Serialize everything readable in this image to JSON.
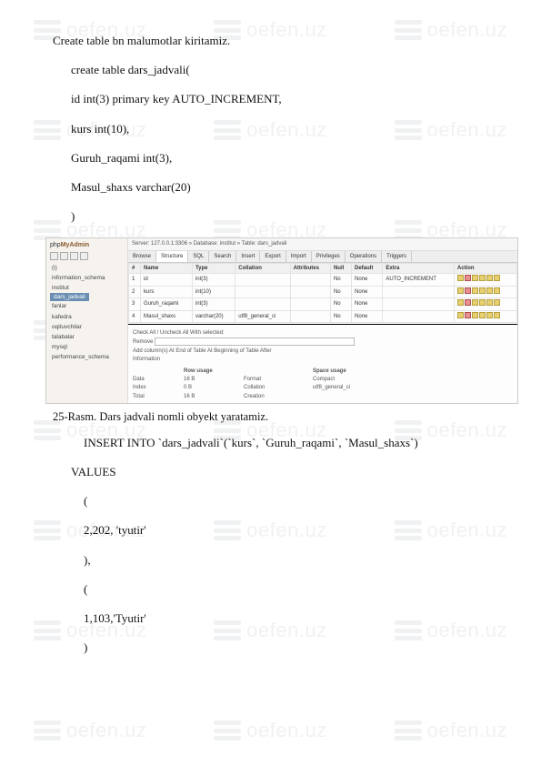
{
  "watermark": "oefen.uz",
  "body": {
    "l1": "Create table bn malumotlar kiritamiz.",
    "l2": "create table dars_jadvali(",
    "l3": "id int(3) primary key AUTO_INCREMENT,",
    "l4": "kurs int(10),",
    "l5": "Guruh_raqami int(3),",
    "l6": "Masul_shaxs varchar(20)",
    "l7": ")"
  },
  "shot": {
    "logo_a": "php",
    "logo_b": "MyAdmin",
    "tree": {
      "t1": "(i)",
      "t2": "information_schema",
      "t3": "institut",
      "t4": "dars_jadvali",
      "t5": "fanlar",
      "t6": "kafedra",
      "t7": "oqituvchilar",
      "t8": "talabalar",
      "t9": "mysql",
      "t10": "performance_schema"
    },
    "crumb": "Server: 127.0.0.1:3306 » Database: institut » Table: dars_jadvali",
    "tabs": {
      "a": "Browse",
      "b": "Structure",
      "c": "SQL",
      "d": "Search",
      "e": "Insert",
      "f": "Export",
      "g": "Import",
      "h": "Privileges",
      "i": "Operations",
      "j": "Triggers"
    },
    "grid": {
      "h_num": "#",
      "h_name": "Name",
      "h_type": "Type",
      "h_coll": "Collation",
      "h_attr": "Attributes",
      "h_null": "Null",
      "h_def": "Default",
      "h_extra": "Extra",
      "h_action": "Action",
      "r1_num": "1",
      "r1_name": "id",
      "r1_type": "int(3)",
      "r1_null": "No",
      "r1_def": "None",
      "r1_extra": "AUTO_INCREMENT",
      "r2_num": "2",
      "r2_name": "kurs",
      "r2_type": "int(10)",
      "r2_null": "No",
      "r2_def": "None",
      "r3_num": "3",
      "r3_name": "Guruh_raqami",
      "r3_type": "int(3)",
      "r3_null": "No",
      "r3_def": "None",
      "r4_num": "4",
      "r4_name": "Masul_shaxs",
      "r4_type": "varchar(20)",
      "r4_coll": "utf8_general_ci",
      "r4_null": "No",
      "r4_def": "None"
    },
    "lower": {
      "checkall": "Check All / Uncheck All With selected:",
      "remove": "Remove",
      "add": "Add",
      "cols": "column(s)  At End of Table  At Beginning of Table  After",
      "info": "Information",
      "rowhd": "Row usage",
      "space": "Space usage",
      "datalbl": "Data",
      "dataval": "16 B",
      "idxlbl": "Index",
      "idxval": "0 B",
      "totlbl": "Total",
      "totval": "16 B",
      "fmtlbl": "Format",
      "fmtval": "Compact",
      "collbl": "Collation",
      "colval": "utf8_general_ci",
      "crelbl": "Creation",
      "creval": ""
    }
  },
  "caption": "25-Rasm. Dars jadvali nomli obyekt yaratamiz.",
  "sql": {
    "s1": "INSERT INTO `dars_jadvali`(`kurs`, `Guruh_raqami`, `Masul_shaxs`)",
    "s2": "VALUES",
    "s3": "(",
    "s4": "2,202, 'tyutir'",
    "s5": "),",
    "s6": "(",
    "s7": "1,103,'Tyutir'",
    "s8": ")"
  }
}
